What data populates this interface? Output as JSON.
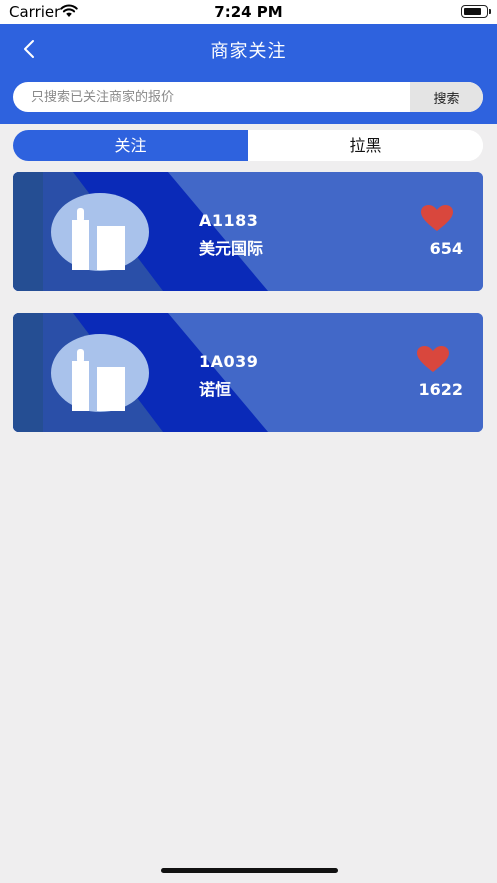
{
  "status_bar": {
    "carrier": "Carrier",
    "time": "7:24 PM"
  },
  "header": {
    "title": "商家关注",
    "back_icon": "chevron-left-icon"
  },
  "search": {
    "placeholder": "只搜索已关注商家的报价",
    "value": "",
    "button_label": "搜索"
  },
  "tabs": [
    {
      "label": "关注",
      "active": true
    },
    {
      "label": "拉黑",
      "active": false
    }
  ],
  "merchants": [
    {
      "code": "A1183",
      "name": "美元国际",
      "likes": "654",
      "icon": "heart-icon"
    },
    {
      "code": "1A039",
      "name": "诺恒",
      "likes": "1622",
      "icon": "heart-icon"
    }
  ],
  "colors": {
    "primary": "#2e62de",
    "card": "#4268c8",
    "heart": "#d9473d",
    "background": "#efeeef"
  }
}
